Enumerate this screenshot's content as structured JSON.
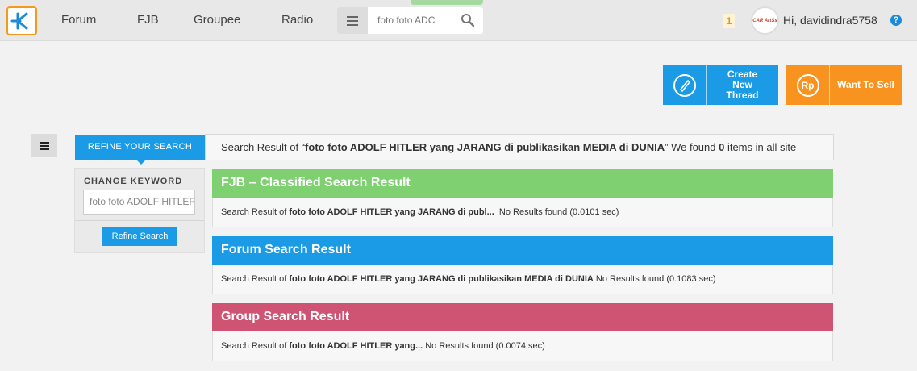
{
  "nav": {
    "items": [
      "Forum",
      "FJB",
      "Groupee",
      "Radio"
    ],
    "search_value": "foto foto ADC",
    "notification_count": "1",
    "avatar_text": "CAR ArtSs",
    "greeting": "Hi, davidindra5758"
  },
  "actions": {
    "create_label": "Create New Thread",
    "sell_label": "Want To Sell",
    "rp_label": "Rp"
  },
  "refine": {
    "tab_label": "REFINE YOUR SEARCH",
    "change_keyword_label": "CHANGE KEYWORD",
    "keyword_value": "foto foto ADOLF HITLER",
    "button_label": "Refine Search"
  },
  "summary": {
    "prefix": "Search Result of “",
    "query": "foto foto ADOLF HITLER yang JARANG di publikasikan MEDIA di DUNIA",
    "middle": "” We found ",
    "count": "0",
    "suffix": " items in all site"
  },
  "sections": [
    {
      "title": "FJB – Classified Search Result",
      "color": "#7ed070",
      "prefix": "Search Result of ",
      "query": "foto foto ADOLF HITLER yang JARANG di publ...",
      "status": "  No Results found (0.0101 sec)"
    },
    {
      "title": "Forum Search Result",
      "color": "#1b9be6",
      "prefix": "Search Result of ",
      "query": "foto foto ADOLF HITLER yang JARANG di publikasikan MEDIA di DUNIA",
      "status": " No Results found (0.1083 sec)"
    },
    {
      "title": "Group Search Result",
      "color": "#cf5373",
      "prefix": "Search Result of ",
      "query": "foto foto ADOLF HITLER yang...",
      "status": " No Results found (0.0074 sec)"
    }
  ]
}
